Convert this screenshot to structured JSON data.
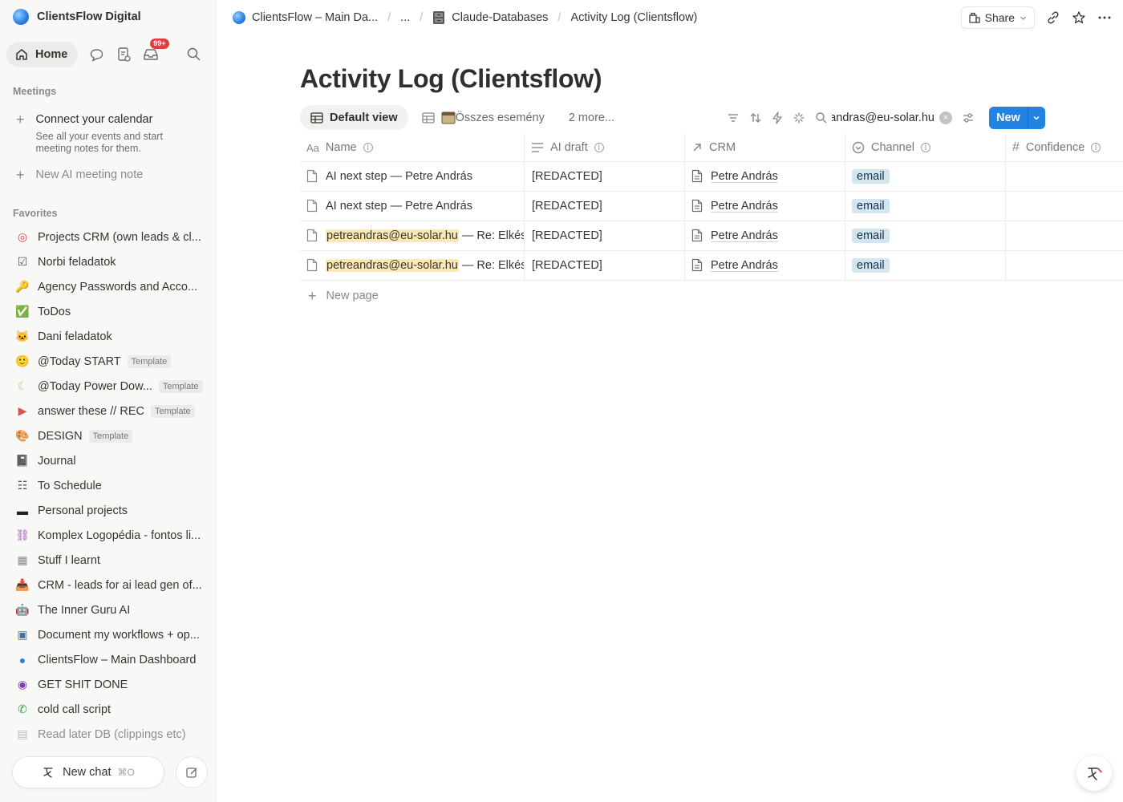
{
  "workspace": {
    "name": "ClientsFlow Digital"
  },
  "nav": {
    "home": "Home",
    "inbox_badge": "99+"
  },
  "meetings": {
    "label": "Meetings",
    "connect_title": "Connect your calendar",
    "connect_desc": "See all your events and start meeting notes for them.",
    "new_note": "New AI meeting note"
  },
  "favorites": {
    "label": "Favorites",
    "items": [
      {
        "icon": "target",
        "label": "Projects CRM (own leads & cl...",
        "template": ""
      },
      {
        "icon": "check-box",
        "label": "Norbi feladatok",
        "template": ""
      },
      {
        "icon": "key",
        "label": "Agency Passwords and Acco...",
        "template": ""
      },
      {
        "icon": "green-check",
        "label": "ToDos",
        "template": ""
      },
      {
        "icon": "cat",
        "label": "Dani feladatok",
        "template": ""
      },
      {
        "icon": "smile",
        "label": "@Today START",
        "template": "Template"
      },
      {
        "icon": "moon",
        "label": "@Today Power Dow...",
        "template": "Template"
      },
      {
        "icon": "video",
        "label": "answer these // REC",
        "template": "Template"
      },
      {
        "icon": "palette",
        "label": "DESIGN",
        "template": "Template"
      },
      {
        "icon": "notebook",
        "label": "Journal",
        "template": ""
      },
      {
        "icon": "ledger",
        "label": "To Schedule",
        "template": ""
      },
      {
        "icon": "sunglasses",
        "label": "Personal projects",
        "template": ""
      },
      {
        "icon": "link",
        "label": "Komplex Logopédia - fontos li...",
        "template": ""
      },
      {
        "icon": "table",
        "label": "Stuff I learnt",
        "template": ""
      },
      {
        "icon": "inbox-tray",
        "label": "CRM - leads for ai lead gen of...",
        "template": ""
      },
      {
        "icon": "robot",
        "label": "The Inner Guru AI",
        "template": ""
      },
      {
        "icon": "chip",
        "label": "Document my workflows + op...",
        "template": ""
      },
      {
        "icon": "globe-blue",
        "label": "ClientsFlow – Main Dashboard",
        "template": ""
      },
      {
        "icon": "eye-purple",
        "label": "GET SHIT DONE",
        "template": ""
      },
      {
        "icon": "phone-green",
        "label": "cold call script",
        "template": ""
      },
      {
        "icon": "clipboard",
        "label": "Read later DB (clippings etc)",
        "template": ""
      }
    ]
  },
  "bottom": {
    "new_chat": "New chat",
    "shortcut": "⌘O"
  },
  "breadcrumb": {
    "item1": "ClientsFlow – Main Da...",
    "ellipsis": "...",
    "item2": "Claude-Databases",
    "item3": "Activity Log (Clientsflow)"
  },
  "topbar": {
    "share": "Share"
  },
  "page": {
    "title": "Activity Log (Clientsflow)"
  },
  "views": {
    "default": "Default view",
    "second": "Összes esemény",
    "more": "2 more..."
  },
  "search": {
    "query": "petreandras@eu-solar.hu"
  },
  "toolbar": {
    "new": "New"
  },
  "table": {
    "columns": [
      "Name",
      "AI draft",
      "CRM",
      "Channel",
      "Confidence"
    ],
    "rows": [
      {
        "name_hl": "",
        "name": "AI next step — Petre András",
        "draft": "[REDACTED]",
        "crm": "Petre András",
        "channel": "email"
      },
      {
        "name_hl": "",
        "name": "AI next step — Petre András",
        "draft": "[REDACTED]",
        "crm": "Petre András",
        "channel": "email"
      },
      {
        "name_hl": "petreandras@eu-solar.hu",
        "name": " — Re: Elkészült",
        "draft": "[REDACTED]",
        "crm": "Petre András",
        "channel": "email"
      },
      {
        "name_hl": "petreandras@eu-solar.hu",
        "name": " — Re: Elkészült",
        "draft": "[REDACTED]",
        "crm": "Petre András",
        "channel": "email"
      }
    ],
    "new_page": "New page"
  }
}
